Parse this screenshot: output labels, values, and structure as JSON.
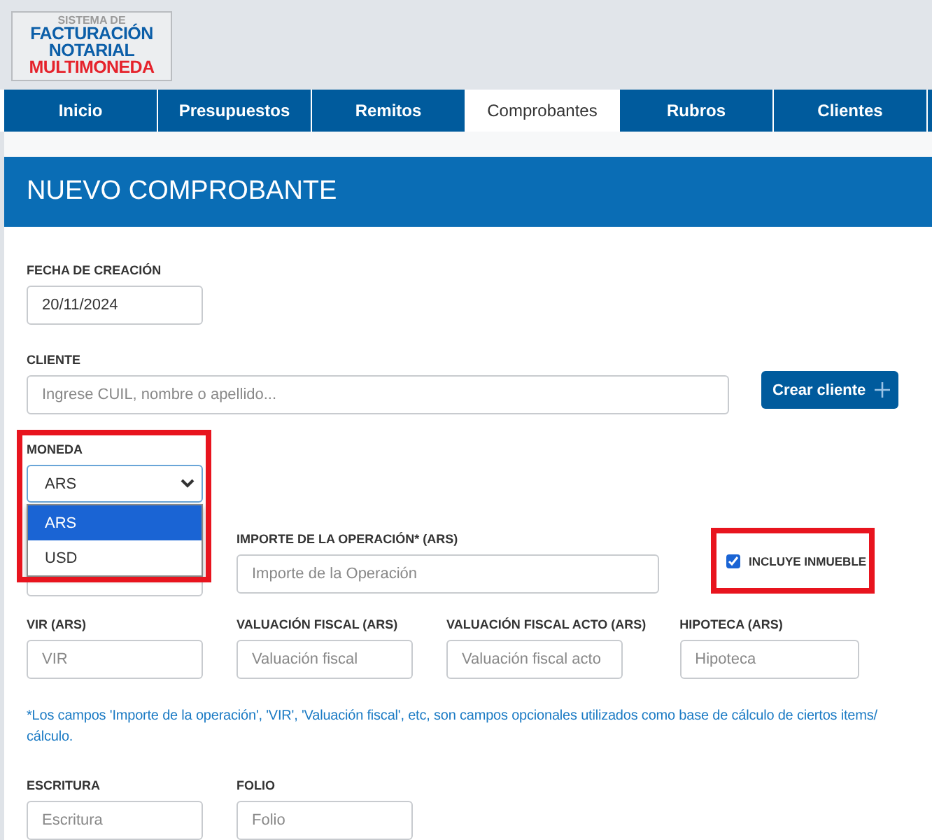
{
  "logo": {
    "lines": [
      "SISTEMA DE",
      "FACTURACIÓN",
      "NOTARIAL",
      "MULTIMONEDA"
    ]
  },
  "nav": [
    {
      "label": "Inicio",
      "selected": false
    },
    {
      "label": "Presupuestos",
      "selected": false
    },
    {
      "label": "Remitos",
      "selected": false
    },
    {
      "label": "Comprobantes",
      "selected": true
    },
    {
      "label": "Rubros",
      "selected": false
    },
    {
      "label": "Clientes",
      "selected": false
    }
  ],
  "card": {
    "title": "NUEVO COMPROBANTE"
  },
  "fecha": {
    "label": "FECHA DE CREACIÓN",
    "value": "20/11/2024"
  },
  "cliente": {
    "label": "CLIENTE",
    "placeholder": "Ingrese CUIL, nombre o apellido...",
    "button": "Crear cliente"
  },
  "moneda": {
    "label": "MONEDA",
    "value": "ARS",
    "expanded": true,
    "highlighted": true,
    "options": [
      {
        "label": "ARS",
        "selected": true
      },
      {
        "label": "USD",
        "selected": false
      }
    ]
  },
  "importe": {
    "label": "IMPORTE DE LA OPERACIÓN* (ARS)",
    "placeholder": "Importe de la Operación"
  },
  "inmueble": {
    "label": "INCLUYE INMUEBLE",
    "checked": true,
    "highlighted": true
  },
  "valores": [
    {
      "label": "VIR (ARS)",
      "placeholder": "VIR"
    },
    {
      "label": "VALUACIÓN FISCAL (ARS)",
      "placeholder": "Valuación fiscal"
    },
    {
      "label": "VALUACIÓN FISCAL ACTO (ARS)",
      "placeholder": "Valuación fiscal acto"
    },
    {
      "label": "HIPOTECA (ARS)",
      "placeholder": "Hipoteca"
    }
  ],
  "note": [
    "*Los campos 'Importe de la operación', 'VIR', 'Valuación fiscal', etc, son campos opcionales utilizados como base de cálculo de ciertos items/",
    "cálculo."
  ],
  "registro": [
    {
      "label": "ESCRITURA",
      "placeholder": "Escritura"
    },
    {
      "label": "FOLIO",
      "placeholder": "Folio"
    }
  ]
}
